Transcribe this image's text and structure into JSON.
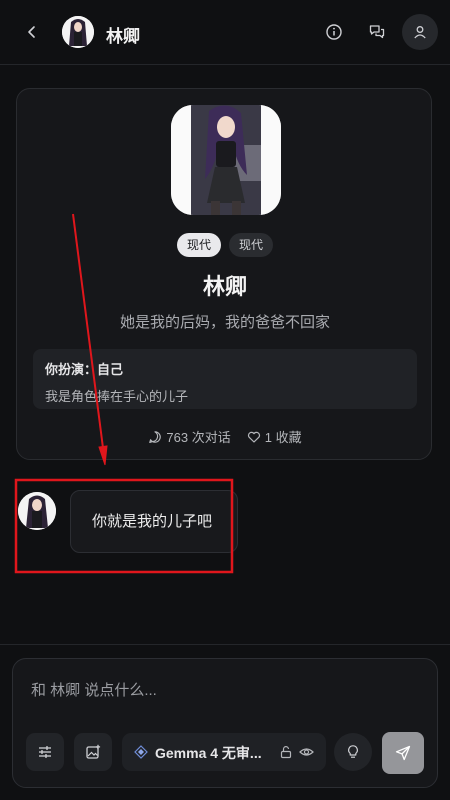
{
  "header": {
    "title": "林卿",
    "back_icon": "chevron-left-icon",
    "info_icon": "info-icon",
    "chats_icon": "chat-bubbles-icon",
    "profile_icon": "user-icon"
  },
  "character": {
    "tags": [
      "现代",
      "现代"
    ],
    "name": "林卿",
    "description": "她是我的后妈，我的爸爸不回家",
    "role_label": "你扮演：",
    "role_value": "自己",
    "role_desc": "我是角色捧在手心的儿子",
    "conversations": "763 次对话",
    "favorites": "1 收藏"
  },
  "messages": [
    {
      "sender": "林卿",
      "text": "你就是我的儿子吧"
    }
  ],
  "composer": {
    "placeholder": "和 林卿 说点什么...",
    "model_name": "Gemma 4 无审..."
  },
  "colors": {
    "background": "#0f1012",
    "card": "#16171a",
    "annotation_red": "#e0161c"
  }
}
